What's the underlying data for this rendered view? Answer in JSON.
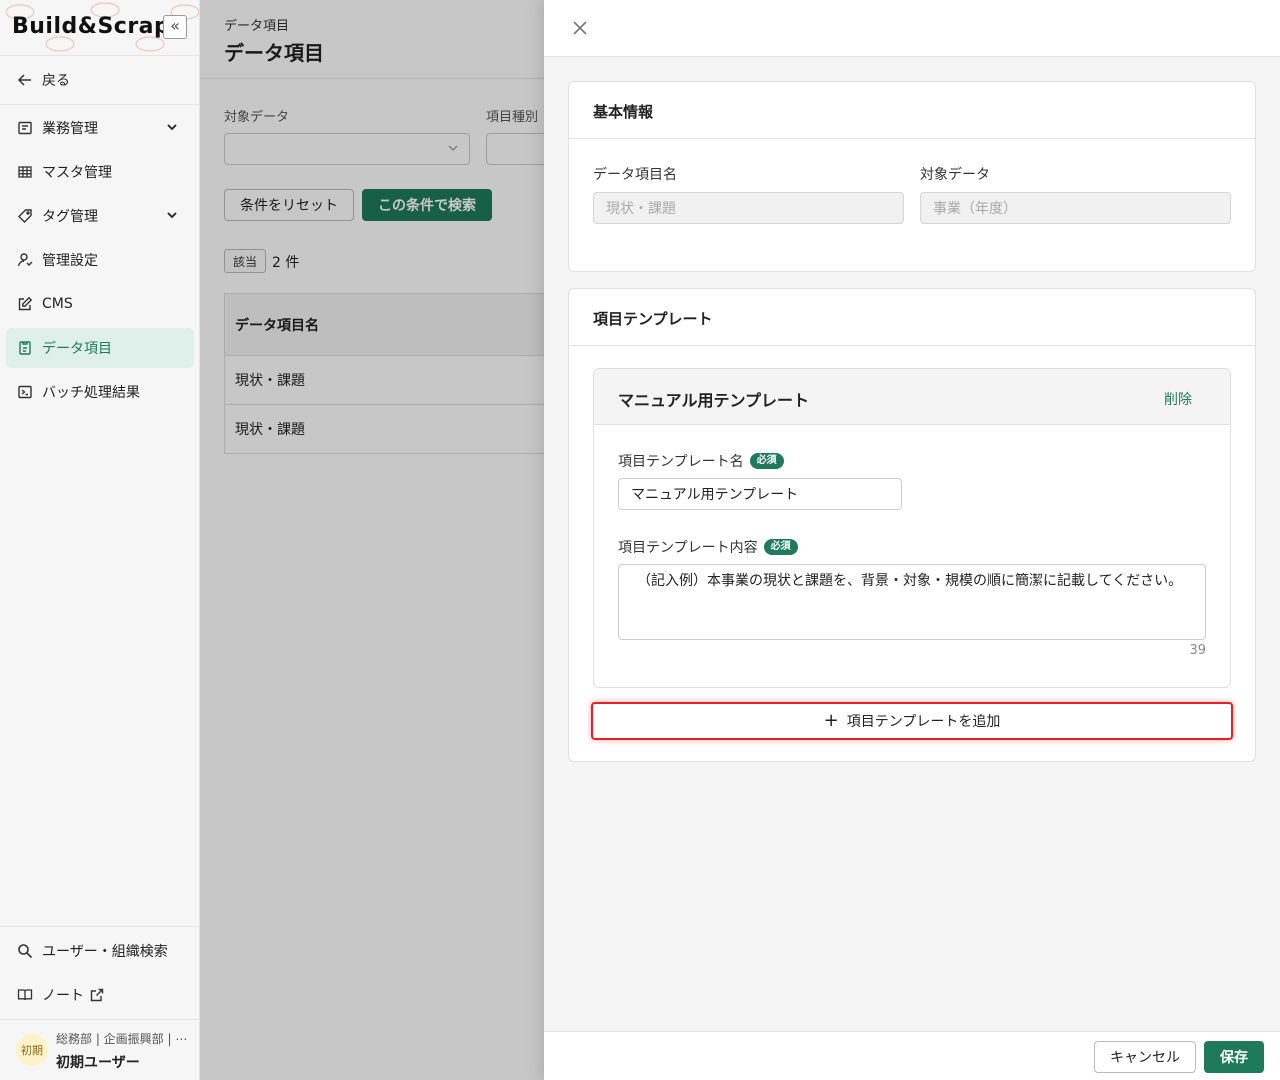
{
  "app": {
    "logo_text": "Build&Scrap",
    "collapse_label": "«"
  },
  "sidebar": {
    "back_label": "戻る",
    "items": [
      {
        "label": "業務管理",
        "icon": "business-icon",
        "has_chevron": true
      },
      {
        "label": "マスタ管理",
        "icon": "table-icon",
        "has_chevron": false
      },
      {
        "label": "タグ管理",
        "icon": "tag-icon",
        "has_chevron": true
      },
      {
        "label": "管理設定",
        "icon": "admin-user-icon",
        "has_chevron": false
      },
      {
        "label": "CMS",
        "icon": "edit-icon",
        "has_chevron": false
      },
      {
        "label": "データ項目",
        "icon": "data-item-icon",
        "has_chevron": false,
        "active": true
      },
      {
        "label": "バッチ処理結果",
        "icon": "terminal-icon",
        "has_chevron": false
      }
    ],
    "bottom_items": [
      {
        "label": "ユーザー・組織検索",
        "icon": "search-icon"
      },
      {
        "label": "ノート",
        "icon": "book-icon"
      }
    ],
    "user": {
      "avatar_text": "初期",
      "org": "総務部 | 企画振興部 | ⋯",
      "name": "初期ユーザー"
    }
  },
  "main": {
    "breadcrumb": "データ項目",
    "title": "データ項目",
    "filter_target_label": "対象データ",
    "filter_type_label": "項目種別",
    "reset_button": "条件をリセット",
    "search_button": "この条件で検索",
    "hit_badge": "該当",
    "hit_count": "2 件",
    "table": {
      "header": "データ項目名",
      "rows": [
        "現状・課題",
        "現状・課題"
      ]
    }
  },
  "drawer": {
    "basic_info": {
      "title": "基本情報",
      "name_label": "データ項目名",
      "name_value": "現状・課題",
      "target_label": "対象データ",
      "target_value": "事業（年度）"
    },
    "templates": {
      "title": "項目テンプレート",
      "item": {
        "title": "マニュアル用テンプレート",
        "delete_label": "削除",
        "name_label": "項目テンプレート名",
        "name_value": "マニュアル用テンプレート",
        "content_label": "項目テンプレート内容",
        "content_value": "（記入例）本事業の現状と課題を、背景・対象・規模の順に簡潔に記載してください。",
        "char_count": "39",
        "required_label": "必須"
      },
      "add_button": "項目テンプレートを追加"
    },
    "footer": {
      "cancel": "キャンセル",
      "save": "保存"
    }
  },
  "colors": {
    "accent": "#1e7a5a",
    "highlight": "#e0232a",
    "active_bg": "#dff0ea"
  }
}
